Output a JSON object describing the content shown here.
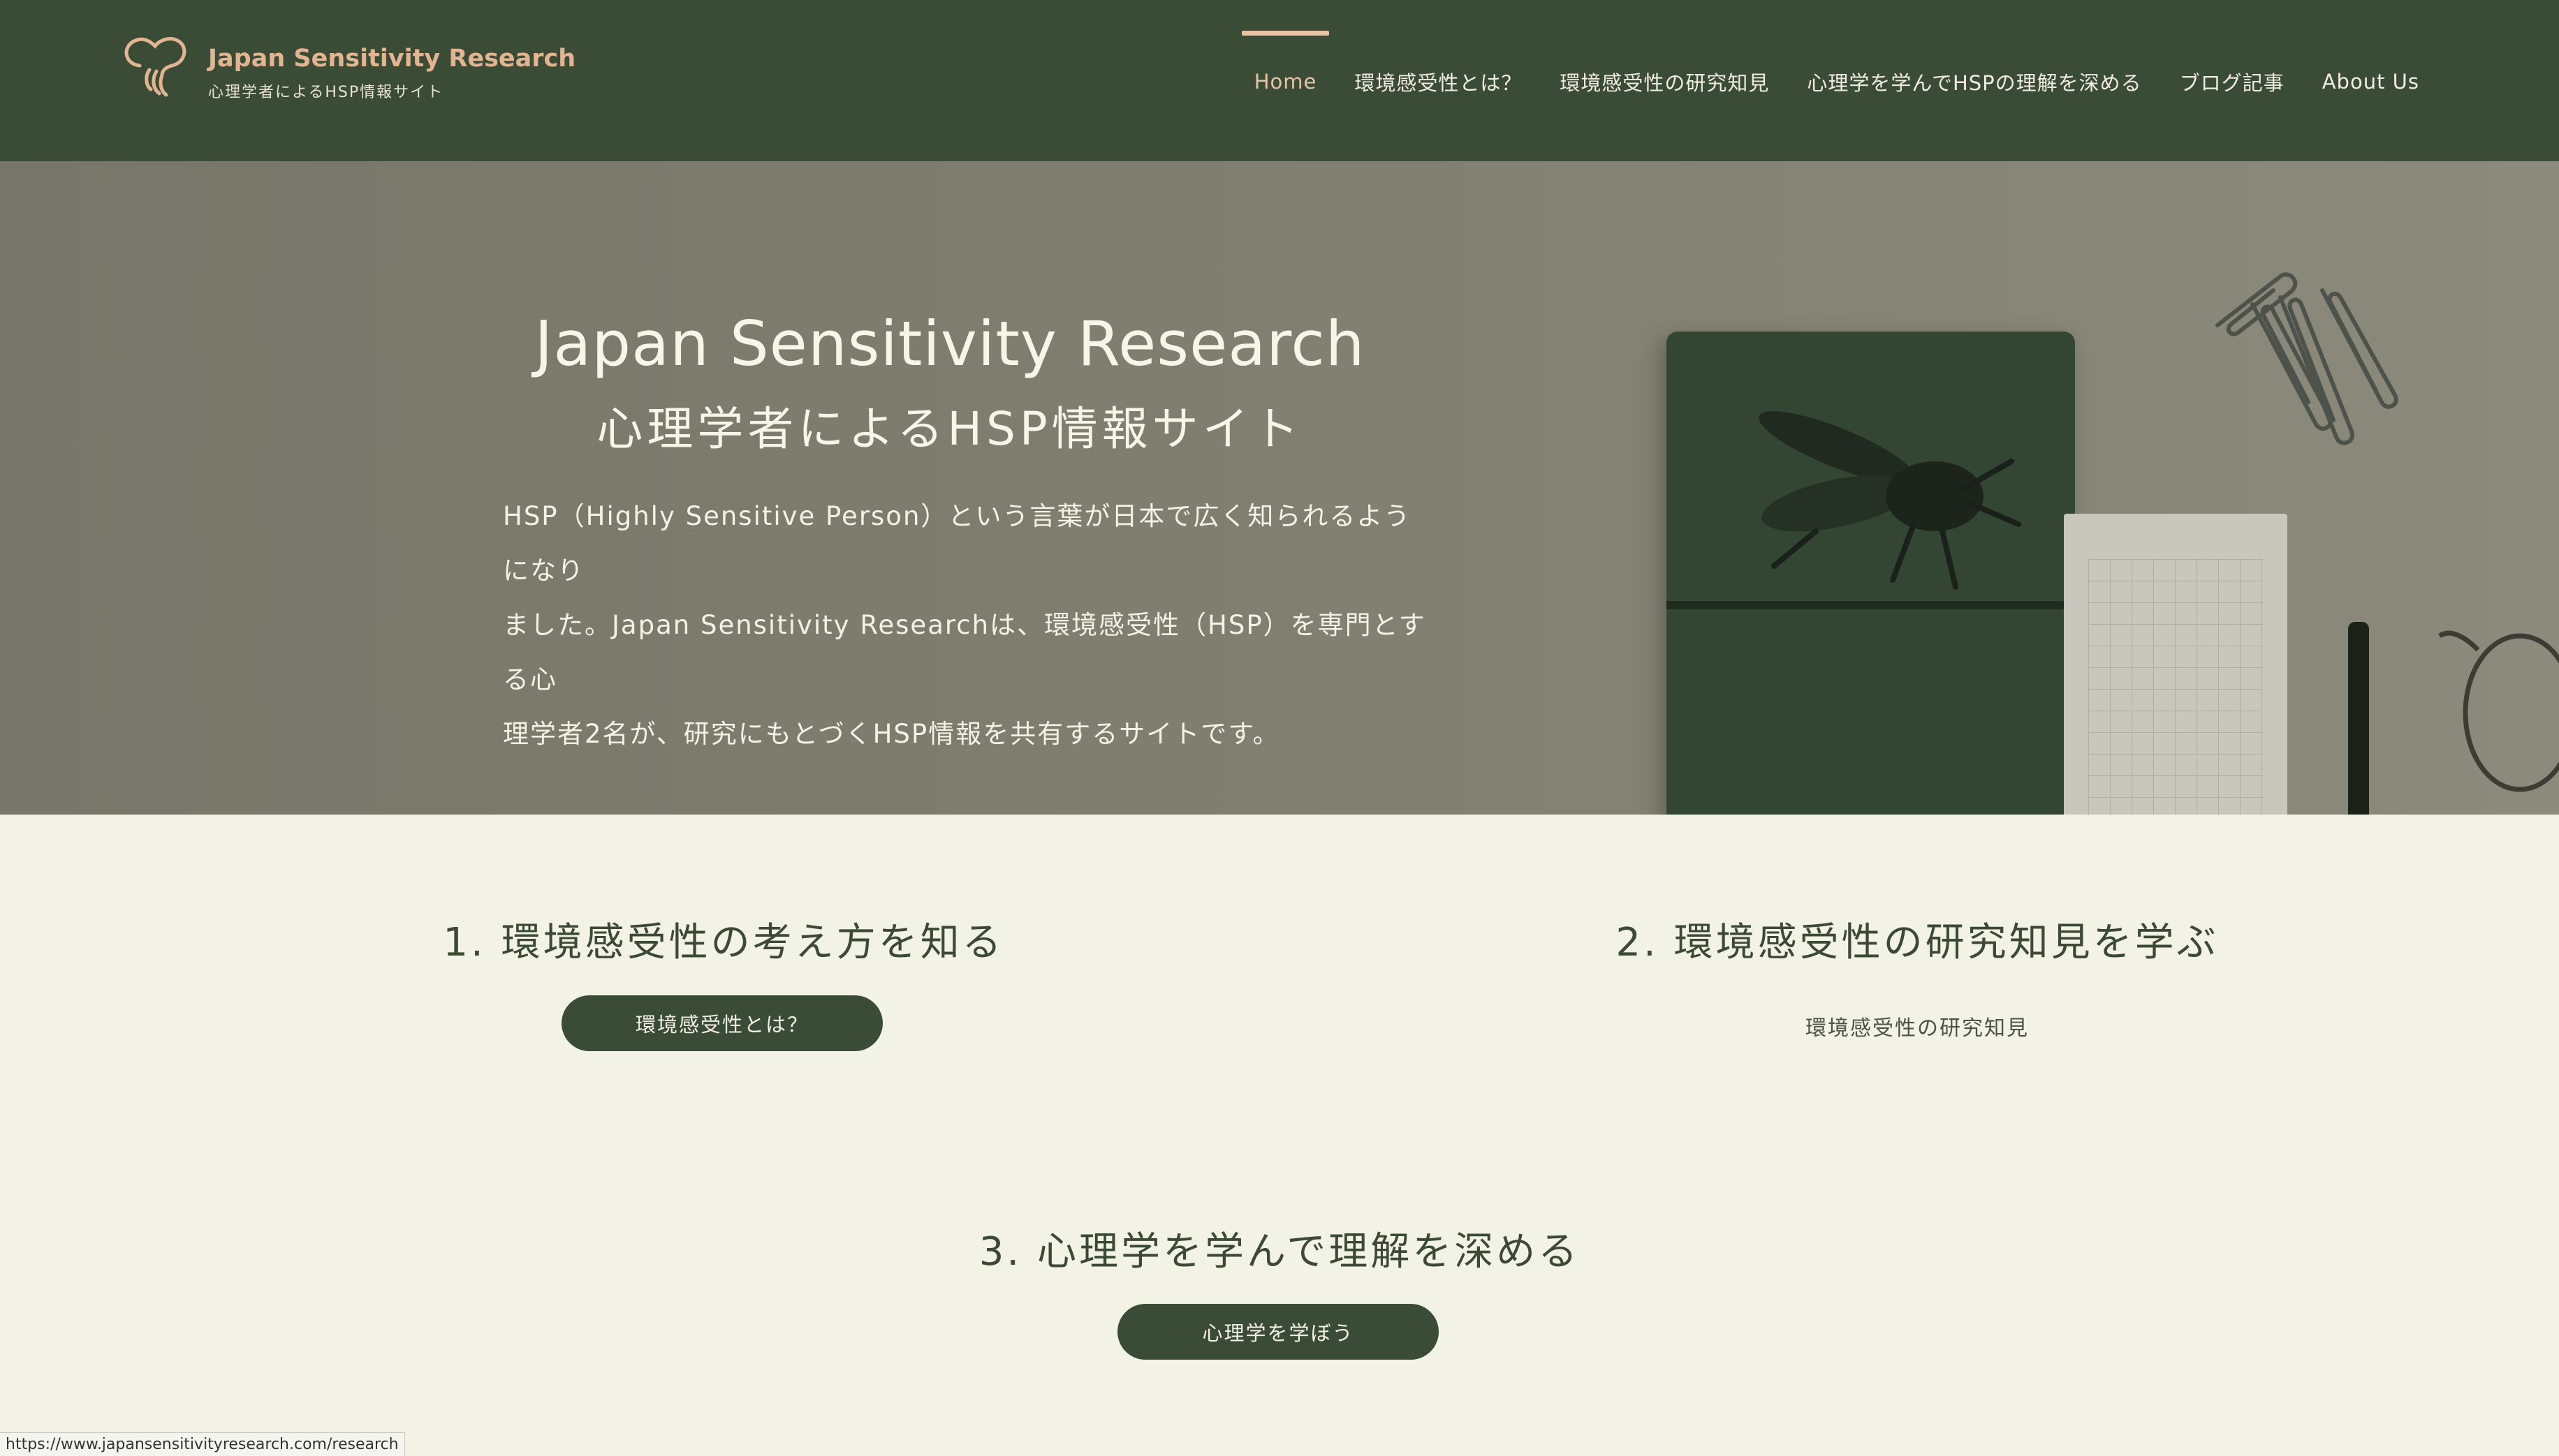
{
  "header": {
    "site_title": "Japan Sensitivity Research",
    "site_subtitle": "心理学者によるHSP情報サイト",
    "logo_icon": "brain-swirl-icon",
    "nav": [
      {
        "label": "Home",
        "active": true
      },
      {
        "label": "環境感受性とは？",
        "active": false
      },
      {
        "label": "環境感受性の研究知見",
        "active": false
      },
      {
        "label": "心理学を学んでHSPの理解を深める",
        "active": false
      },
      {
        "label": "ブログ記事",
        "active": false
      },
      {
        "label": "About Us",
        "active": false
      }
    ]
  },
  "hero": {
    "title": "Japan Sensitivity Research",
    "subtitle": "心理学者によるHSP情報サイト",
    "description_lines": [
      "HSP（Highly Sensitive Person）という言葉が日本で広く知られるようになり",
      "ました。Japan Sensitivity Researchは、環境感受性（HSP）を専門とする心",
      "理学者2名が、研究にもとづくHSP情報を共有するサイトです。"
    ]
  },
  "sections": [
    {
      "title": "1. 環境感受性の考え方を知る",
      "button": "環境感受性とは？"
    },
    {
      "title": "2. 環境感受性の研究知見を学ぶ",
      "link": "環境感受性の研究知見"
    },
    {
      "title": "3. 心理学を学んで理解を深める",
      "button": "心理学を学ぼう"
    }
  ],
  "status_url": "https://www.japansensitivityresearch.com/research",
  "colors": {
    "header_bg": "#3b4c36",
    "accent": "#e2b592",
    "page_bg": "#f2f2e6",
    "button_bg": "#3b4c36"
  }
}
